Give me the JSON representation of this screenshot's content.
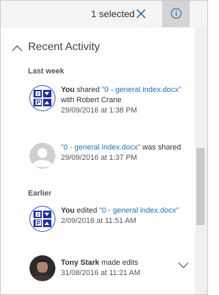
{
  "topbar": {
    "selected_label": "1 selected",
    "close_icon": "close-icon",
    "info_icon": "info-icon",
    "accent_color": "#1a73c2"
  },
  "panel": {
    "title": "Recent Activity",
    "toggle_icon": "chevron-up-icon"
  },
  "groups": [
    {
      "heading": "Last week",
      "items": [
        {
          "avatar": "ip-logo-avatar",
          "actor": "You",
          "action_before": " shared ",
          "file": "\"0 - general index.docx\"",
          "action_after": " with Robert Crane",
          "timestamp": "29/09/2016 at 1:38 PM"
        },
        {
          "avatar": "generic-person-avatar",
          "actor": "",
          "action_before": "",
          "file": "\"0 - general index.docx\"",
          "action_after": " was shared",
          "timestamp": "29/09/2016 at 1:37 PM"
        }
      ]
    },
    {
      "heading": "Earlier",
      "items": [
        {
          "avatar": "ip-logo-avatar",
          "actor": "You",
          "action_before": " edited ",
          "file": "\"0 - general index.docx\"",
          "action_after": "",
          "timestamp": "2/09/2016 at 11:51 AM"
        },
        {
          "avatar": "tony-stark-photo-avatar",
          "actor": "Tony Stark",
          "action_before": " made edits",
          "file": "",
          "action_after": "",
          "timestamp": "31/08/2016 at 11:21 AM"
        }
      ]
    }
  ],
  "expand_icon": "chevron-down-icon"
}
